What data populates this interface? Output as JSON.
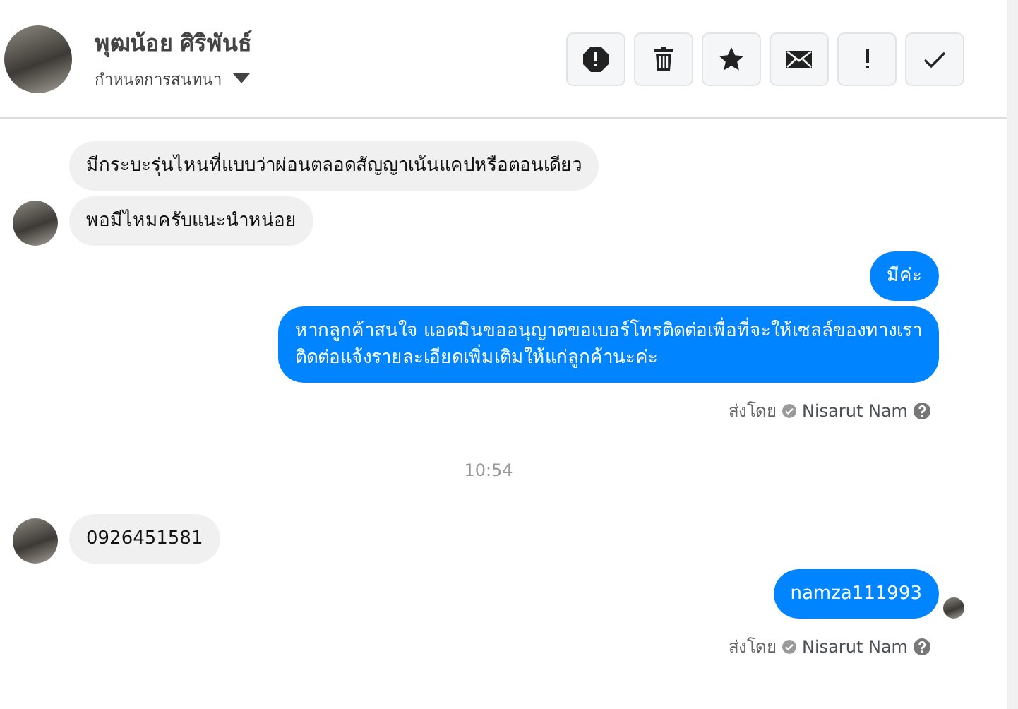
{
  "header": {
    "name": "พุฒน้อย ศิริพันธ์",
    "subtitle": "กำหนดการสนทนา"
  },
  "messages": [
    {
      "kind": "incoming",
      "text": "มีกระบะรุ่นไหนที่แบบว่าผ่อนตลอดสัญญาเน้นแคปหรือตอนเดียว",
      "avatar": false
    },
    {
      "kind": "incoming",
      "text": "พอมีไหมครับแนะนำหน่อย",
      "avatar": true
    },
    {
      "kind": "outgoing",
      "text": "มีค่ะ"
    },
    {
      "kind": "outgoing",
      "text": "หากลูกค้าสนใจ แอดมินขออนุญาตขอเบอร์โทรติดต่อเพื่อที่จะให้เซลล์ของทางเรา\nติดต่อแจ้งรายละเอียดเพิ่มเติมให้แก่ลูกค้านะค่ะ"
    },
    {
      "kind": "sent_by",
      "label": "ส่งโดย",
      "sender": "Nisarut Nam"
    },
    {
      "kind": "time",
      "text": "10:54"
    },
    {
      "kind": "incoming",
      "text": "0926451581",
      "avatar": true
    },
    {
      "kind": "outgoing",
      "text": "namza111993",
      "seen": true
    },
    {
      "kind": "sent_by",
      "label": "ส่งโดย",
      "sender": "Nisarut Nam"
    }
  ]
}
